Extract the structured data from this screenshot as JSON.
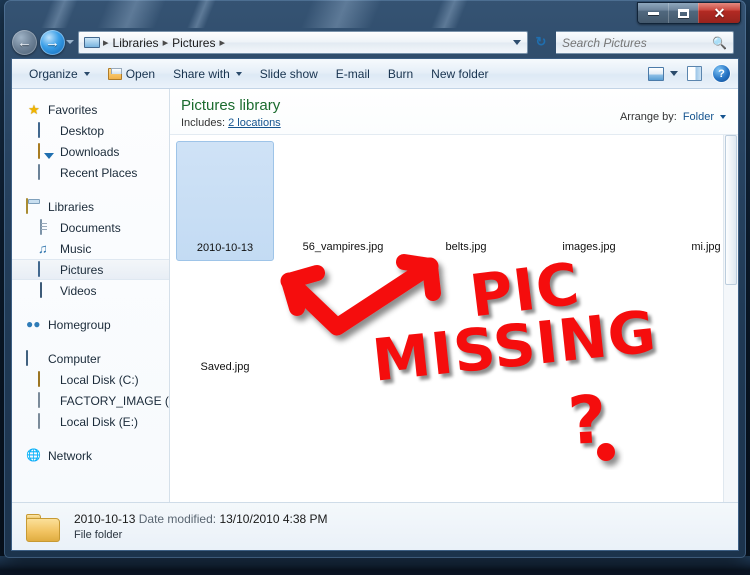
{
  "window": {
    "caption_buttons": [
      {
        "name": "minimize",
        "label": "–"
      },
      {
        "name": "maximize",
        "label": "□"
      },
      {
        "name": "close",
        "label": "✕"
      }
    ]
  },
  "navbar": {
    "back_glyph": "←",
    "forward_glyph": "→",
    "address": {
      "root_icon": "pictures-library-icon",
      "crumbs": [
        "Libraries",
        "Pictures"
      ],
      "separator": "▸"
    },
    "refresh_glyph": "↻",
    "search": {
      "placeholder": "Search Pictures",
      "value": "",
      "icon": "🔍"
    }
  },
  "command_bar": {
    "items": [
      {
        "label": "Organize",
        "has_caret": true,
        "icon": null
      },
      {
        "label": "Open",
        "has_caret": false,
        "icon": "open-folder-icon"
      },
      {
        "label": "Share with",
        "has_caret": true,
        "icon": null
      },
      {
        "label": "Slide show",
        "has_caret": false,
        "icon": null
      },
      {
        "label": "E-mail",
        "has_caret": false,
        "icon": null
      },
      {
        "label": "Burn",
        "has_caret": false,
        "icon": null
      },
      {
        "label": "New folder",
        "has_caret": false,
        "icon": null
      }
    ],
    "help_label": "?"
  },
  "nav_pane": {
    "groups": [
      {
        "header": {
          "label": "Favorites",
          "icon": "star-icon"
        },
        "items": [
          {
            "label": "Desktop",
            "icon": "monitor-icon"
          },
          {
            "label": "Downloads",
            "icon": "downloads-folder-icon"
          },
          {
            "label": "Recent Places",
            "icon": "recent-places-icon"
          }
        ]
      },
      {
        "header": {
          "label": "Libraries",
          "icon": "libraries-icon"
        },
        "items": [
          {
            "label": "Documents",
            "icon": "documents-icon"
          },
          {
            "label": "Music",
            "icon": "music-icon"
          },
          {
            "label": "Pictures",
            "icon": "pictures-icon",
            "selected": true
          },
          {
            "label": "Videos",
            "icon": "videos-icon"
          }
        ]
      },
      {
        "header": {
          "label": "Homegroup",
          "icon": "homegroup-icon"
        },
        "items": []
      },
      {
        "header": {
          "label": "Computer",
          "icon": "computer-icon"
        },
        "items": [
          {
            "label": "Local Disk (C:)",
            "icon": "system-drive-icon"
          },
          {
            "label": "FACTORY_IMAGE (D:",
            "icon": "drive-icon"
          },
          {
            "label": "Local Disk (E:)",
            "icon": "drive-icon"
          }
        ]
      },
      {
        "header": {
          "label": "Network",
          "icon": "network-icon"
        },
        "items": []
      }
    ]
  },
  "library_header": {
    "title": "Pictures library",
    "includes_label": "Includes:",
    "locations_link": "2 locations",
    "arrange_label": "Arrange by:",
    "arrange_value": "Folder"
  },
  "files": [
    {
      "name": "2010-10-13",
      "type": "folder",
      "selected": true,
      "thumb": "blank"
    },
    {
      "name": "56_vampires.jpg",
      "type": "image",
      "selected": false,
      "thumb": "missing"
    },
    {
      "name": "belts.jpg",
      "type": "image",
      "selected": false,
      "thumb": "missing"
    },
    {
      "name": "images.jpg",
      "type": "image",
      "selected": false,
      "thumb": "missing"
    },
    {
      "name": "mi.jpg",
      "type": "image",
      "selected": false,
      "thumb": "missing"
    },
    {
      "name": "Saved.jpg",
      "type": "image",
      "selected": false,
      "thumb": "missing"
    }
  ],
  "details_bar": {
    "item_name": "2010-10-13",
    "date_modified_label": "Date modified:",
    "date_modified_value": "13/10/2010 4:38 PM",
    "item_type": "File folder"
  },
  "annotation": {
    "color": "#f50d0d",
    "words": {
      "pic": "PIC",
      "missing": "MISSING",
      "question": "?"
    },
    "arrow_description": "double-headed-v-arrow"
  }
}
